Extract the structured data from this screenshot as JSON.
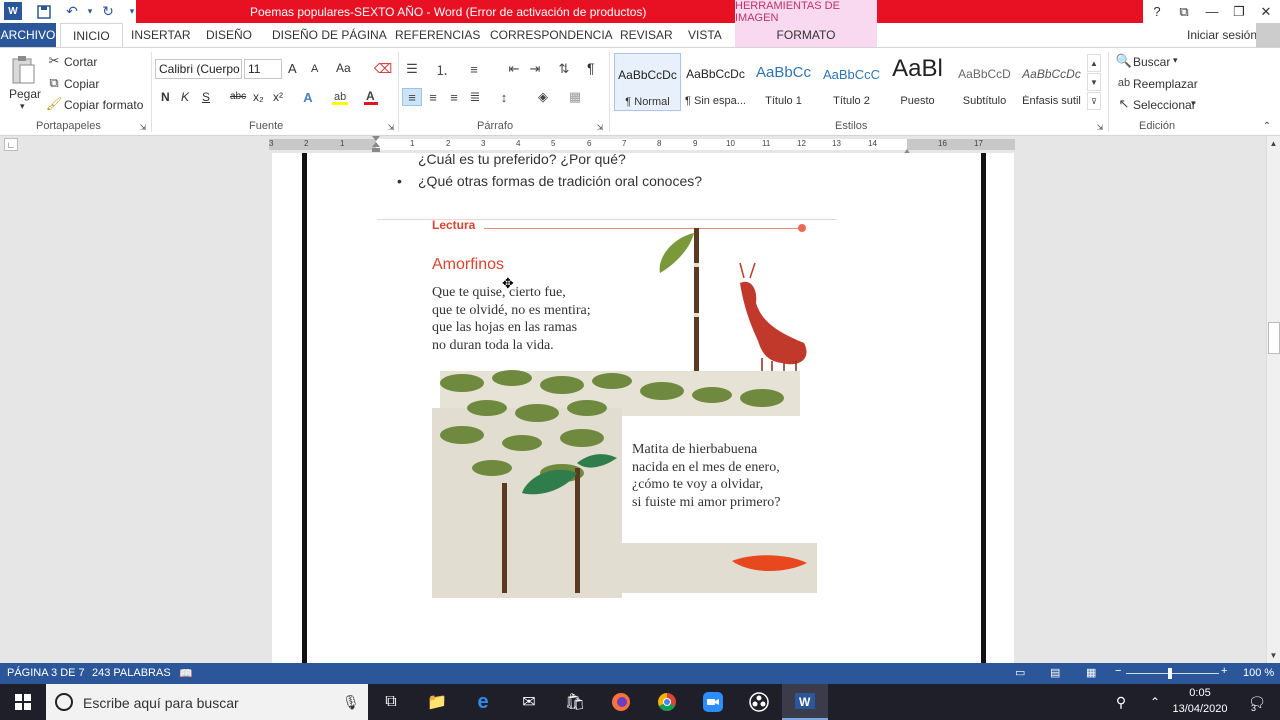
{
  "app": {
    "title": "Poemas populares-SEXTO AÑO  -  Word (Error de activación de productos)",
    "context_header": "HERRAMIENTAS DE IMAGEN",
    "signin": "Iniciar sesión",
    "help": "?"
  },
  "tabs": [
    "ARCHIVO",
    "INICIO",
    "INSERTAR",
    "DISEÑO",
    "DISEÑO DE PÁGINA",
    "REFERENCIAS",
    "CORRESPONDENCIA",
    "REVISAR",
    "VISTA",
    "FORMATO"
  ],
  "clipboard": {
    "paste": "Pegar",
    "cut": "Cortar",
    "copy": "Copiar",
    "format_painter": "Copiar formato",
    "label": "Portapapeles"
  },
  "font": {
    "name": "Calibri (Cuerpo",
    "size": "11",
    "grow": "A",
    "shrink": "A",
    "case": "Aa",
    "bold": "N",
    "italic": "K",
    "underline": "S",
    "strike": "abc",
    "sub": "x₂",
    "sup": "x²",
    "label": "Fuente"
  },
  "paragraph": {
    "label": "Párrafo",
    "pilcrow": "¶"
  },
  "styles": {
    "label": "Estilos",
    "items": [
      {
        "sample": "AaBbCcDc",
        "name": "¶ Normal"
      },
      {
        "sample": "AaBbCcDc",
        "name": "¶ Sin espa..."
      },
      {
        "sample": "AaBbCc",
        "name": "Título 1"
      },
      {
        "sample": "AaBbCcC",
        "name": "Título 2"
      },
      {
        "sample": "AaBl",
        "name": "Puesto"
      },
      {
        "sample": "AaBbCcD",
        "name": "Subtítulo"
      },
      {
        "sample": "AaBbCcDc",
        "name": "Énfasis sutil"
      }
    ]
  },
  "editing": {
    "find": "Buscar",
    "replace": "Reemplazar",
    "select": "Seleccionar",
    "label": "Edición"
  },
  "ruler": {
    "left_ticks": [
      "3",
      "2",
      "1"
    ],
    "right_ticks": [
      "1",
      "2",
      "3",
      "4",
      "5",
      "6",
      "7",
      "8",
      "9",
      "10",
      "11",
      "12",
      "13",
      "14",
      "16",
      "17"
    ]
  },
  "document": {
    "bullet_1": "¿Cuál es tu preferido? ¿Por qué?",
    "bullet_2": "¿Qué otras formas de tradición oral conoces?",
    "section": "Lectura",
    "poem_title": "Amorfinos",
    "stanza_1": [
      "Que te quise, cierto fue,",
      "que te olvidé, no es mentira;",
      "que las hojas en las ramas",
      "no duran toda la vida."
    ],
    "stanza_2": [
      "Matita de hierbabuena",
      "nacida en el mes de enero,",
      "¿cómo te voy a olvidar,",
      "si fuiste mi amor primero?"
    ]
  },
  "status": {
    "page": "PÁGINA 3 DE 7",
    "words": "243 PALABRAS",
    "zoom": "100 %"
  },
  "taskbar": {
    "search_placeholder": "Escribe aquí para buscar",
    "time": "0:05",
    "date": "13/04/2020",
    "notifications": "3"
  },
  "colors": {
    "word_blue": "#2b579a",
    "title_red": "#e81123",
    "accent_red": "#d9432f"
  }
}
